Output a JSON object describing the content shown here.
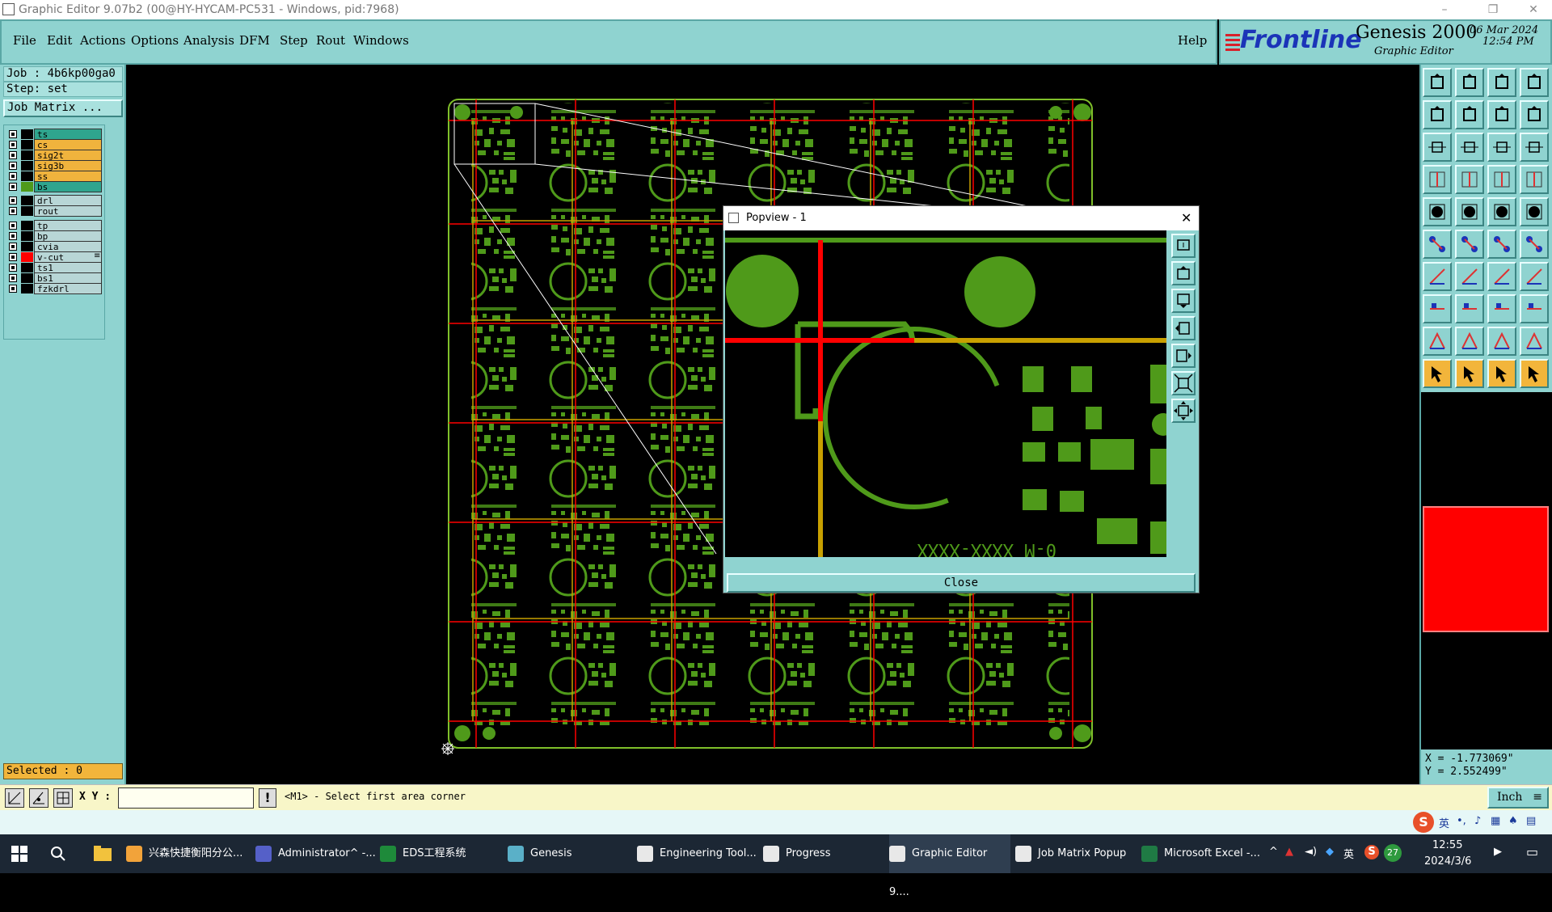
{
  "window": {
    "title": "Graphic Editor 9.07b2 (00@HY-HYCAM-PC531 - Windows, pid:7968)",
    "minimize_glyph": "–",
    "restore_glyph": "❐",
    "close_glyph": "✕"
  },
  "menu": {
    "items": [
      "File",
      "Edit",
      "Actions",
      "Options",
      "Analysis",
      "DFM",
      "Step",
      "Rout",
      "Windows"
    ],
    "help": "Help"
  },
  "logo": {
    "brand": "Frontline",
    "product": "Genesis 2000",
    "subtitle": "Graphic Editor",
    "date": "06 Mar 2024",
    "time": "12:54 PM",
    "brand_color": "#1b34b8",
    "stripe_color": "#d8202a"
  },
  "info": {
    "job": "Job : 4b6kp00ga0",
    "step": "Step: set",
    "job_matrix": "Job Matrix ..."
  },
  "layers": [
    {
      "name": "ts",
      "color": "#2fa58e",
      "swatch": "#000"
    },
    {
      "name": "cs",
      "color": "#f0b33d",
      "swatch": "#000"
    },
    {
      "name": "sig2t",
      "color": "#f0b33d",
      "swatch": "#000"
    },
    {
      "name": "sig3b",
      "color": "#f0b33d",
      "swatch": "#000"
    },
    {
      "name": "ss",
      "color": "#f0b33d",
      "swatch": "#000"
    },
    {
      "name": "bs",
      "color": "#2fa58e",
      "swatch": "#4f9a1a"
    },
    {
      "name": "drl",
      "color": "#b8d6d6",
      "swatch": "#000"
    },
    {
      "name": "rout",
      "color": "#b8d6d6",
      "swatch": "#000"
    },
    {
      "name": "tp",
      "color": "#b8d6d6",
      "swatch": "#000"
    },
    {
      "name": "bp",
      "color": "#b8d6d6",
      "swatch": "#000"
    },
    {
      "name": "cvia",
      "color": "#b8d6d6",
      "swatch": "#000"
    },
    {
      "name": "v-cut",
      "color": "#b8d6d6",
      "swatch": "#ff0000",
      "marker": "≡"
    },
    {
      "name": "ts1",
      "color": "#b8d6d6",
      "swatch": "#000"
    },
    {
      "name": "bs1",
      "color": "#b8d6d6",
      "swatch": "#000"
    },
    {
      "name": "fzkdrl",
      "color": "#b8d6d6",
      "swatch": "#000"
    }
  ],
  "selected": "Selected : 0",
  "popup": {
    "title": "Popview - 1",
    "close_label": "Close",
    "silk_text": "0-M XXXX-XXXX"
  },
  "coordinates": {
    "x": "X = -1.773069\"",
    "y": "Y = 2.552499\""
  },
  "command": {
    "xy_label": "X Y :",
    "input_value": "",
    "prompt": "<M1> - Select first area corner",
    "units": "Inch"
  },
  "taskbar": {
    "items": [
      {
        "label": "兴森快捷衡阳分公...",
        "icon_color": "#f2a33a"
      },
      {
        "label": "Administrator^ -...",
        "icon_color": "#5560c8"
      },
      {
        "label": "EDS工程系统",
        "icon_color": "#1e8a3a"
      },
      {
        "label": "Genesis",
        "icon_color": "#5ab0c8"
      },
      {
        "label": "Engineering Tool...",
        "icon_color": "#e8e8e8"
      },
      {
        "label": "Progress",
        "icon_color": "#e8e8e8"
      },
      {
        "label": "Graphic Editor 9....",
        "icon_color": "#e8e8e8",
        "active": true
      },
      {
        "label": "Job Matrix Popup",
        "icon_color": "#e8e8e8"
      },
      {
        "label": "Microsoft Excel -...",
        "icon_color": "#1f7a44"
      }
    ],
    "tray": {
      "ime": "英",
      "badge": "27",
      "time": "12:55",
      "date": "2024/3/6"
    }
  },
  "ime_toolbar": {
    "lang": "英"
  },
  "colors": {
    "panel": "#8fd3d0",
    "board_outline": "#7fbf2a",
    "copper": "#4f9a1a",
    "red_line": "#ff0000",
    "yellow_line": "#c8a000"
  }
}
